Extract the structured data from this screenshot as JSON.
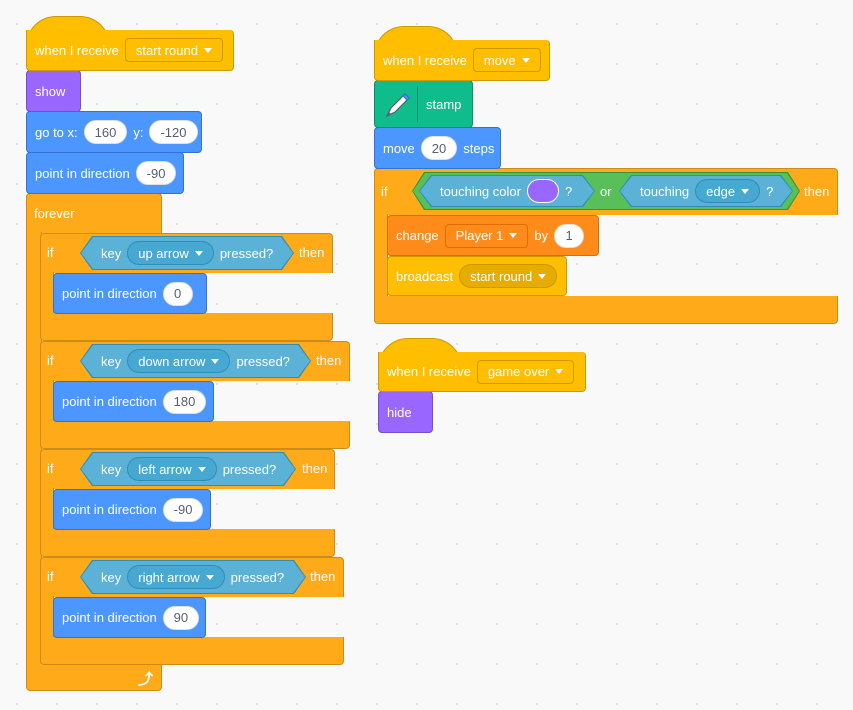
{
  "colors": {
    "events": "#ffbf00",
    "control": "#ffab19",
    "motion": "#4c97ff",
    "looks": "#9966ff",
    "pen": "#0fbd8c",
    "variables": "#ff8c1a",
    "sensing": "#5cb1d6",
    "operators": "#59c059",
    "touching_color_value": "#9966ff"
  },
  "script1": {
    "hat": {
      "label": "when I receive",
      "message": "start round"
    },
    "show": "show",
    "goto": {
      "label_x": "go to x:",
      "x": "160",
      "label_y": "y:",
      "y": "-120"
    },
    "point": {
      "label": "point in direction",
      "value": "-90"
    },
    "forever": "forever",
    "ifs": [
      {
        "if": "if",
        "key": "key",
        "key_value": "up arrow",
        "pressed": "pressed?",
        "then": "then",
        "point_label": "point in direction",
        "point_value": "0"
      },
      {
        "if": "if",
        "key": "key",
        "key_value": "down arrow",
        "pressed": "pressed?",
        "then": "then",
        "point_label": "point in direction",
        "point_value": "180"
      },
      {
        "if": "if",
        "key": "key",
        "key_value": "left arrow",
        "pressed": "pressed?",
        "then": "then",
        "point_label": "point in direction",
        "point_value": "-90"
      },
      {
        "if": "if",
        "key": "key",
        "key_value": "right arrow",
        "pressed": "pressed?",
        "then": "then",
        "point_label": "point in direction",
        "point_value": "90"
      }
    ],
    "loop_arrow_icon": "loop-arrow"
  },
  "script2": {
    "hat": {
      "label": "when I receive",
      "message": "move"
    },
    "stamp": {
      "icon": "pen-icon",
      "label": "stamp"
    },
    "move": {
      "label": "move",
      "value": "20",
      "suffix": "steps"
    },
    "if_block": {
      "if": "if",
      "touching_color": "touching color",
      "q1": "?",
      "or": "or",
      "touching": "touching",
      "touching_value": "edge",
      "q2": "?",
      "then": "then"
    },
    "change": {
      "label": "change",
      "variable": "Player 1",
      "by": "by",
      "value": "1"
    },
    "broadcast": {
      "label": "broadcast",
      "message": "start round"
    }
  },
  "script3": {
    "hat": {
      "label": "when I receive",
      "message": "game over"
    },
    "hide": "hide"
  }
}
